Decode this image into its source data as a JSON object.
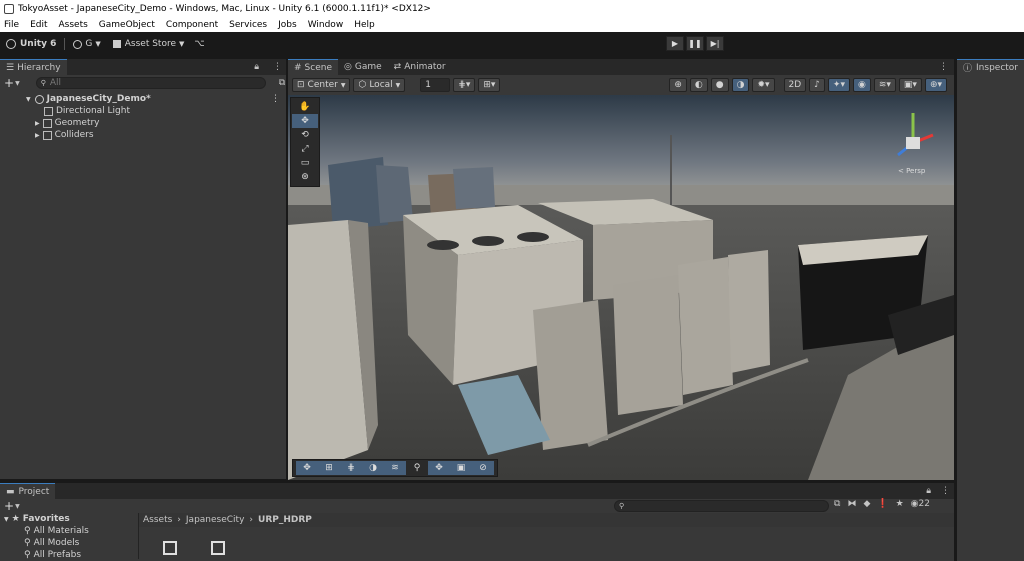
{
  "window": {
    "title": "TokyoAsset - JapaneseCity_Demo - Windows, Mac, Linux - Unity 6.1 (6000.1.11f1)* <DX12>"
  },
  "menu": [
    "File",
    "Edit",
    "Assets",
    "GameObject",
    "Component",
    "Services",
    "Jobs",
    "Window",
    "Help"
  ],
  "toolbar": {
    "unity_label": "Unity 6",
    "account_label": "G",
    "asset_store_label": "Asset Store"
  },
  "hierarchy": {
    "tab_label": "Hierarchy",
    "search_placeholder": "All",
    "scene_name": "JapaneseCity_Demo*",
    "items": [
      "Directional Light",
      "Geometry",
      "Colliders"
    ]
  },
  "scene": {
    "tabs": [
      "Scene",
      "Game",
      "Animator"
    ],
    "pivot_label": "Center",
    "space_label": "Local",
    "grid_value": "1",
    "gizmo_label": "< Persp"
  },
  "inspector": {
    "tab_label": "Inspector"
  },
  "project": {
    "tab_label": "Project",
    "favorites_label": "Favorites",
    "favorites": [
      "All Materials",
      "All Models",
      "All Prefabs"
    ],
    "breadcrumb": [
      "Assets",
      "JapaneseCity",
      "URP_HDRP"
    ],
    "count": "22"
  }
}
